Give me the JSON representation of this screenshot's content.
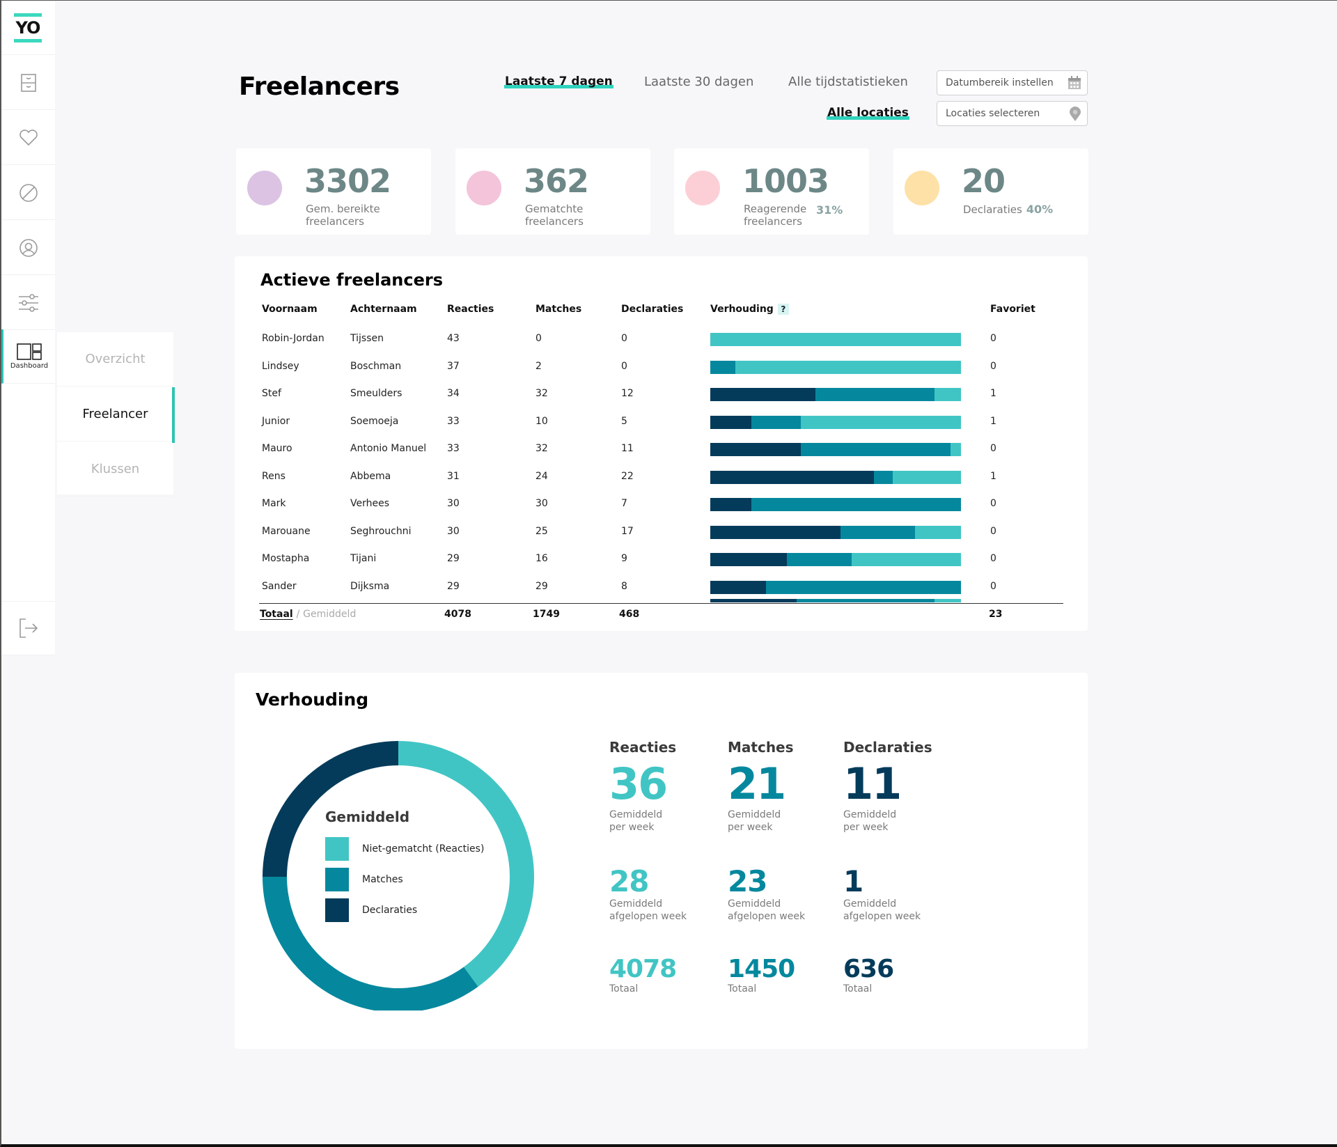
{
  "sidebar": {
    "logo": "YO",
    "items": [
      {
        "icon": "cabinet-icon",
        "label": ""
      },
      {
        "icon": "heart-icon",
        "label": ""
      },
      {
        "icon": "block-icon",
        "label": ""
      },
      {
        "icon": "user-circle-icon",
        "label": ""
      },
      {
        "icon": "sliders-icon",
        "label": ""
      },
      {
        "icon": "dashboard-icon",
        "label": "Dashboard",
        "active": true
      }
    ],
    "logout_icon": "logout-icon"
  },
  "submenu": {
    "items": [
      {
        "label": "Overzicht",
        "active": false
      },
      {
        "label": "Freelancer",
        "active": true
      },
      {
        "label": "Klussen",
        "active": false
      }
    ]
  },
  "header": {
    "title": "Freelancers",
    "time_tabs": [
      {
        "label": "Laatste 7 dagen",
        "active": true
      },
      {
        "label": "Laatste 30 dagen",
        "active": false
      },
      {
        "label": "Alle tijdstatistieken",
        "active": false
      }
    ],
    "location_tab": {
      "label": "Alle locaties",
      "active": true
    },
    "date_range_placeholder": "Datumbereik instellen",
    "location_placeholder": "Locaties selecteren"
  },
  "stats": [
    {
      "value": "3302",
      "label": "Gem. bereikte freelancers",
      "percent": "",
      "dot_color": "#dcc3e3"
    },
    {
      "value": "362",
      "label": "Gematchte freelancers",
      "percent": "",
      "dot_color": "#f3c4da"
    },
    {
      "value": "1003",
      "label": "Reagerende freelancers",
      "percent": "31%",
      "dot_color": "#fccfd6"
    },
    {
      "value": "20",
      "label": "Declaraties",
      "percent": "40%",
      "dot_color": "#fde1a6"
    }
  ],
  "table": {
    "title": "Actieve freelancers",
    "columns": [
      "Voornaam",
      "Achternaam",
      "Reacties",
      "Matches",
      "Declaraties",
      "Verhouding",
      "Favoriet"
    ],
    "help_badge": "?",
    "rows": [
      {
        "first": "Robin-Jordan",
        "last": "Tijssen",
        "reacties": "43",
        "matches": "0",
        "declaraties": "0",
        "ratio": [
          0,
          0,
          1
        ],
        "favoriet": "0"
      },
      {
        "first": "Lindsey",
        "last": "Boschman",
        "reacties": "37",
        "matches": "2",
        "declaraties": "0",
        "ratio": [
          0,
          0.1,
          0.9
        ],
        "favoriet": "0"
      },
      {
        "first": "Stef",
        "last": "Smeulders",
        "reacties": "34",
        "matches": "32",
        "declaraties": "12",
        "ratio": [
          0.42,
          0.475,
          0.105
        ],
        "favoriet": "1"
      },
      {
        "first": "Junior",
        "last": "Soemoeja",
        "reacties": "33",
        "matches": "10",
        "declaraties": "5",
        "ratio": [
          0.165,
          0.197,
          0.638
        ],
        "favoriet": "1"
      },
      {
        "first": "Mauro",
        "last": "Antonio Manuel",
        "reacties": "33",
        "matches": "32",
        "declaraties": "11",
        "ratio": [
          0.362,
          0.597,
          0.041
        ],
        "favoriet": "0"
      },
      {
        "first": "Rens",
        "last": "Abbema",
        "reacties": "31",
        "matches": "24",
        "declaraties": "22",
        "ratio": [
          0.654,
          0.074,
          0.272
        ],
        "favoriet": "1"
      },
      {
        "first": "Mark",
        "last": "Verhees",
        "reacties": "30",
        "matches": "30",
        "declaraties": "7",
        "ratio": [
          0.165,
          0.835,
          0
        ],
        "favoriet": "0"
      },
      {
        "first": "Marouane",
        "last": "Seghrouchni",
        "reacties": "30",
        "matches": "25",
        "declaraties": "17",
        "ratio": [
          0.52,
          0.297,
          0.183
        ],
        "favoriet": "0"
      },
      {
        "first": "Mostapha",
        "last": "Tijani",
        "reacties": "29",
        "matches": "16",
        "declaraties": "9",
        "ratio": [
          0.306,
          0.258,
          0.436
        ],
        "favoriet": "0"
      },
      {
        "first": "Sander",
        "last": "Dijksma",
        "reacties": "29",
        "matches": "29",
        "declaraties": "8",
        "ratio": [
          0.223,
          0.777,
          0
        ],
        "favoriet": "0"
      }
    ],
    "partial_row_ratio": [
      0.345,
      0.55,
      0.105
    ],
    "footer": {
      "total_label": "Totaal",
      "separator": "/",
      "average_label": "Gemiddeld",
      "reacties": "4078",
      "matches": "1749",
      "declaraties": "468",
      "favoriet": "23"
    }
  },
  "verhouding": {
    "title": "Verhouding",
    "legend_title": "Gemiddeld",
    "legend": [
      {
        "label": "Niet-gematcht (Reacties)",
        "color": "#41c5c4"
      },
      {
        "label": "Matches",
        "color": "#05889e"
      },
      {
        "label": "Declaraties",
        "color": "#053b5a"
      }
    ],
    "metrics": [
      {
        "head": "Reacties",
        "per_week": "36",
        "per_week_label": "Gemiddeld per week",
        "last_week": "28",
        "last_week_label": "Gemiddeld afgelopen week",
        "total": "4078",
        "total_label": "Totaal",
        "color": "#41c5c4"
      },
      {
        "head": "Matches",
        "per_week": "21",
        "per_week_label": "Gemiddeld per week",
        "last_week": "23",
        "last_week_label": "Gemiddeld afgelopen week",
        "total": "1450",
        "total_label": "Totaal",
        "color": "#05889e"
      },
      {
        "head": "Declaraties",
        "per_week": "11",
        "per_week_label": "Gemiddeld per week",
        "last_week": "1",
        "last_week_label": "Gemiddeld afgelopen week",
        "total": "636",
        "total_label": "Totaal",
        "color": "#053b5a"
      }
    ]
  },
  "chart_data": {
    "type": "pie",
    "title": "Verhouding",
    "subtitle": "Gemiddeld",
    "categories": [
      "Niet-gematcht (Reacties)",
      "Matches",
      "Declaraties"
    ],
    "values": [
      40,
      35,
      25
    ],
    "unit": "percent (estimated from arc)",
    "donut": true,
    "legend_position": "center"
  },
  "colors": {
    "accent": "#2fd3bd",
    "reacties": "#41c5c4",
    "matches": "#05889e",
    "declaraties": "#053b5a",
    "stat_number": "#6d8787"
  }
}
